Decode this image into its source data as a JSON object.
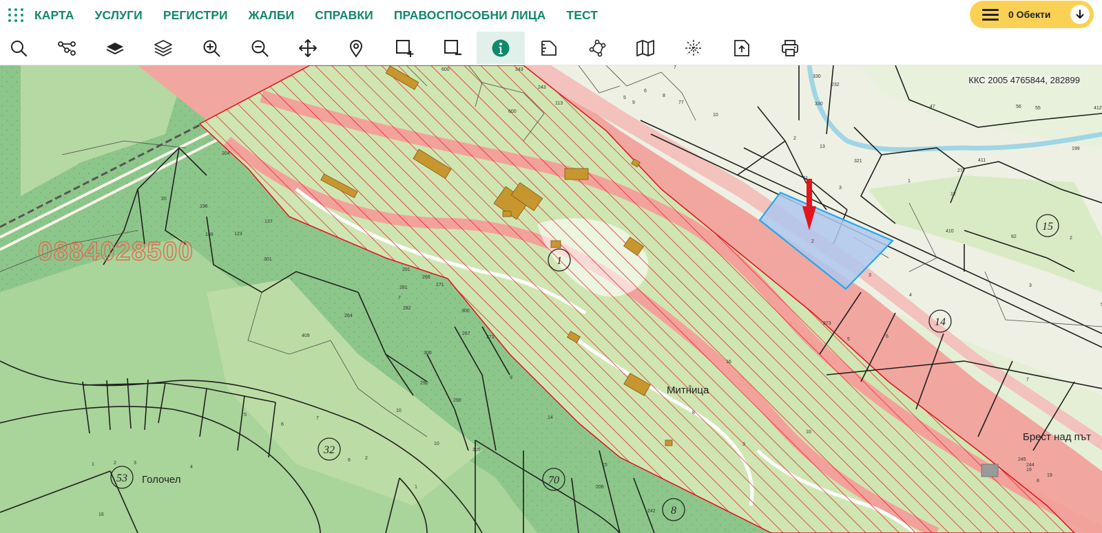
{
  "nav": {
    "items": [
      {
        "label": "КАРТА",
        "name": "nav-karta"
      },
      {
        "label": "УСЛУГИ",
        "name": "nav-uslugi"
      },
      {
        "label": "РЕГИСТРИ",
        "name": "nav-registri"
      },
      {
        "label": "ЖАЛБИ",
        "name": "nav-zhalbi"
      },
      {
        "label": "СПРАВКИ",
        "name": "nav-spravki"
      },
      {
        "label": "ПРАВОСПОСОБНИ ЛИЦА",
        "name": "nav-pravosposobni-lica"
      },
      {
        "label": "ТЕСТ",
        "name": "nav-test"
      }
    ],
    "accent_color": "#13876C"
  },
  "objects_panel": {
    "label": "0 Обекти",
    "color": "#FBD155"
  },
  "toolbar": {
    "tools": [
      "search-icon",
      "route-icon",
      "base-layer-icon",
      "layers-icon",
      "zoom-in-icon",
      "zoom-out-icon",
      "pan-icon",
      "location-pin-icon",
      "select-add-icon",
      "select-remove-icon",
      "info-icon",
      "measure-icon",
      "polygon-icon",
      "map-icon",
      "cadastre-tools-icon",
      "export-icon",
      "print-icon"
    ],
    "active_tool": "info-icon"
  },
  "map": {
    "coordinates": "ККС 2005 4765844, 282899",
    "watermark_phone": "0884028500",
    "place_names": [
      "Митница",
      "Голочел",
      "Брест над път"
    ],
    "zone_numbers": [
      "1",
      "15",
      "14",
      "32",
      "53",
      "70",
      "8"
    ],
    "parcel_numbers": [
      "600",
      "243",
      "243",
      "113",
      "600",
      "7",
      "6",
      "5",
      "9",
      "8",
      "77",
      "330",
      "232",
      "330",
      "10",
      "2",
      "13",
      "321",
      "47",
      "56",
      "55",
      "412",
      "199",
      "411",
      "277",
      "11",
      "3",
      "1",
      "12",
      "410",
      "82",
      "2",
      "2",
      "3",
      "3",
      "4",
      "5",
      "6",
      "7",
      "59",
      "373",
      "16",
      "10",
      "9",
      "8",
      "204",
      "20",
      "196",
      "137",
      "159",
      "123",
      "301",
      "201",
      "266",
      "281",
      "7",
      "271",
      "282",
      "300",
      "264",
      "267",
      "271",
      "306",
      "409",
      "290",
      "290",
      "9",
      "10",
      "14",
      "10",
      "305",
      "15",
      "1",
      "2",
      "3",
      "4",
      "5",
      "6",
      "7",
      "6",
      "2",
      "1",
      "16",
      "206",
      "3",
      "242",
      "245",
      "244",
      "19",
      "19",
      "8"
    ],
    "colors": {
      "forest": "#8DC68A",
      "meadow": "#CDE3AE",
      "road_zone": "#F2A6A0",
      "hatch": "#E10E1A",
      "building": "#C8962E",
      "selected_parcel": "#AFC7EE",
      "selected_outline": "#21A8EA",
      "river": "#9FD6E6",
      "marker": "#E3141C"
    }
  }
}
